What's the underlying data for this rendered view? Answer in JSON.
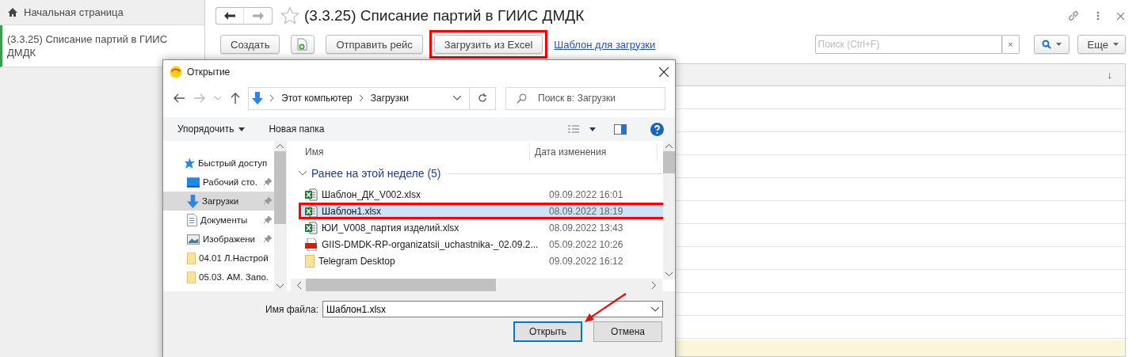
{
  "sidebar": {
    "items": [
      {
        "label": "Начальная страница",
        "kind": "home",
        "selected": false
      },
      {
        "label": "(3.3.25) Списание партий в ГИИС ДМДК",
        "kind": "form",
        "selected": true
      }
    ]
  },
  "form": {
    "title": "(3.3.25) Списание партий в ГИИС ДМДК",
    "favorite": false,
    "toolbar": [
      {
        "kind": "button",
        "label": "Создать",
        "highlighted": false
      },
      {
        "kind": "add-document",
        "highlighted": false
      },
      {
        "kind": "button",
        "label": "Отправить рейс",
        "highlighted": false
      },
      {
        "kind": "button",
        "label": "Загрузить из Excel",
        "highlighted": true
      },
      {
        "kind": "link",
        "label": "Шаблон для загрузки",
        "highlighted": false
      }
    ],
    "search": {
      "placeholder": "Поиск (Ctrl+F)",
      "clear": "×"
    },
    "more": "Еще",
    "sort_mark": "↓"
  },
  "dialog": {
    "title": "Открытие",
    "path": [
      "Этот компьютер",
      "Загрузки"
    ],
    "search": {
      "placeholder": "Поиск в: Загрузки"
    },
    "commands": [
      {
        "label": "Упорядочить",
        "dropdown": true
      },
      {
        "label": "Новая папка",
        "dropdown": false
      }
    ],
    "nav": [
      {
        "label": "Быстрый доступ",
        "kind": "quick",
        "pinned": false,
        "selected": false
      },
      {
        "label": "Рабочий сто.",
        "kind": "desktop",
        "pinned": true,
        "selected": false
      },
      {
        "label": "Загрузки",
        "kind": "downloads",
        "pinned": true,
        "selected": true
      },
      {
        "label": "Документы",
        "kind": "documents",
        "pinned": true,
        "selected": false
      },
      {
        "label": "Изображени",
        "kind": "pictures",
        "pinned": true,
        "selected": false
      },
      {
        "label": "04.01 Л.Настрой",
        "kind": "folder",
        "pinned": false,
        "selected": false
      },
      {
        "label": "05.03. АМ. Запо.",
        "kind": "folder",
        "pinned": false,
        "selected": false
      }
    ],
    "columns": [
      "Имя",
      "Дата изменения"
    ],
    "group": {
      "label": "Ранее на этой неделе (5)",
      "expanded": true
    },
    "files": [
      {
        "name": "Шаблон_ДК_V002.xlsx",
        "kind": "excel",
        "date": "09.09.2022 16:01",
        "selected": false,
        "highlighted": false
      },
      {
        "name": "Шаблон1.xlsx",
        "kind": "excel",
        "date": "08.09.2022 18:19",
        "selected": true,
        "highlighted": true
      },
      {
        "name": "ЮИ_V008_партия изделий.xlsx",
        "kind": "excel",
        "date": "08.09.2022 13:43",
        "selected": false,
        "highlighted": false
      },
      {
        "name": "GIIS-DMDK-RP-organizatsii_uchastnika-_02.09.2...",
        "kind": "pdf",
        "date": "05.09.2022 10:26",
        "selected": false,
        "highlighted": false
      },
      {
        "name": "Telegram Desktop",
        "kind": "folder",
        "date": "09.09.2022 16:12",
        "selected": false,
        "highlighted": false
      }
    ],
    "file_name_label": "Имя файла:",
    "file_name": "Шаблон1.xlsx",
    "buttons": [
      {
        "label": "Открыть",
        "default": true
      },
      {
        "label": "Отмена",
        "default": false
      }
    ]
  }
}
